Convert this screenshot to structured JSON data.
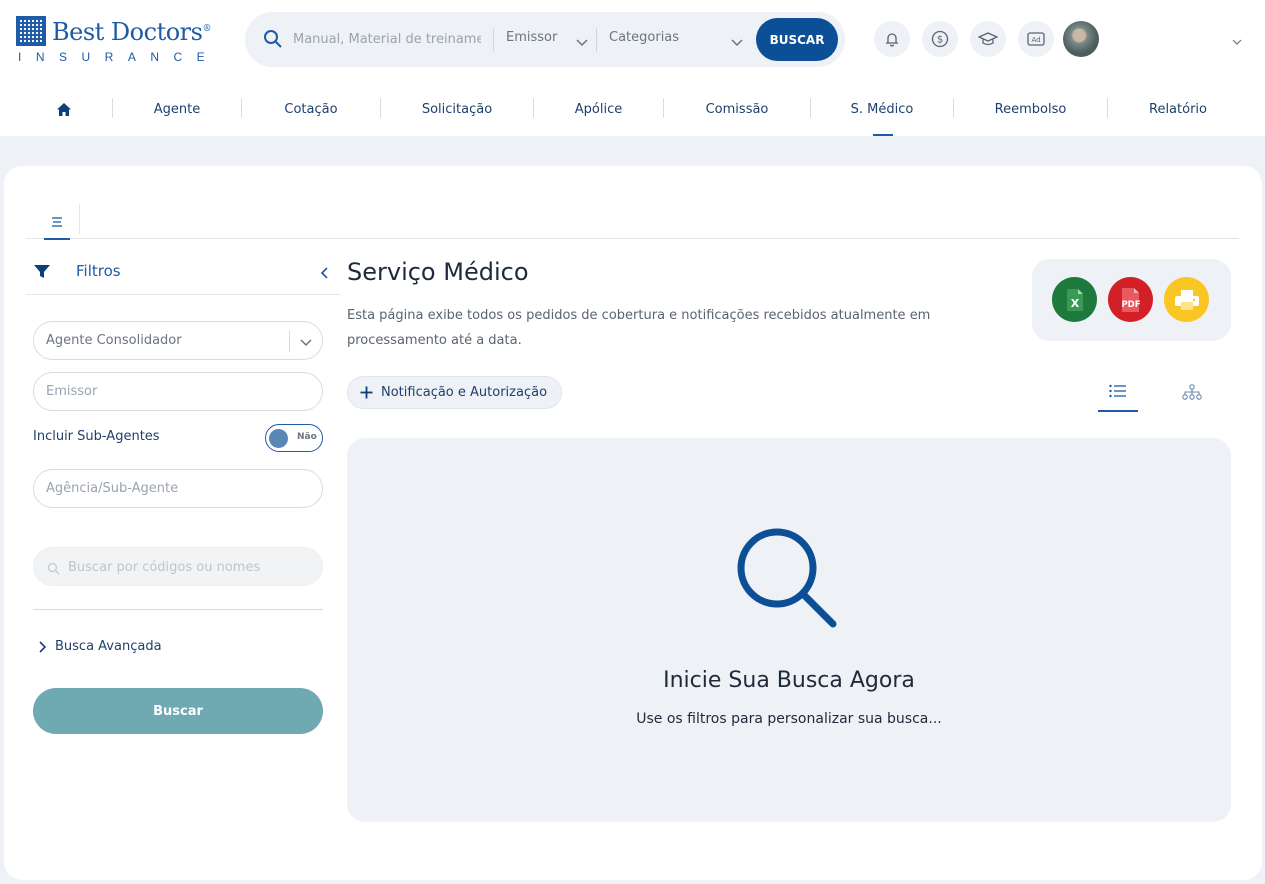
{
  "brand": {
    "name": "Best Doctors",
    "registered": "®",
    "sub": "INSURANCE",
    "color": "#1f5aa6"
  },
  "search": {
    "placeholder": "Manual, Material de treinamento",
    "issuer": "Emissor",
    "categories": "Categorias",
    "button": "BUSCAR"
  },
  "header_icons": [
    "bell-icon",
    "dollar-icon",
    "graduation-cap-icon",
    "ad-icon"
  ],
  "nav": {
    "home": "home-icon",
    "items": [
      "Agente",
      "Cotação",
      "Solicitação",
      "Apólice",
      "Comissão",
      "S. Médico",
      "Reembolso",
      "Relatório"
    ],
    "active": "S. Médico"
  },
  "filters": {
    "title": "Filtros",
    "consolidated_agent": "Agente Consolidador",
    "issuer_placeholder": "Emissor",
    "include_sub_agents": "Incluir Sub-Agentes",
    "toggle_state": "Não",
    "agency_placeholder": "Agência/Sub-Agente",
    "code_search_placeholder": "Buscar por códigos ou nomes",
    "advanced": "Busca Avançada",
    "search_button": "Buscar"
  },
  "content": {
    "title": "Serviço Médico",
    "description": "Esta página exibe todos os pedidos de cobertura e notificações recebidos atualmente em processamento até a data.",
    "add_button": "Notificação e Autorização",
    "export": {
      "excel": "X",
      "pdf": "PDF"
    },
    "empty_title": "Inicie Sua Busca Agora",
    "empty_sub": "Use os filtros para personalizar sua busca..."
  },
  "colors": {
    "primary": "#0d4f96",
    "accent": "#1f5aa6",
    "excel": "#1e7a3c",
    "pdf": "#d32027",
    "print": "#f9c623",
    "search_button": "#6fa9b2"
  }
}
